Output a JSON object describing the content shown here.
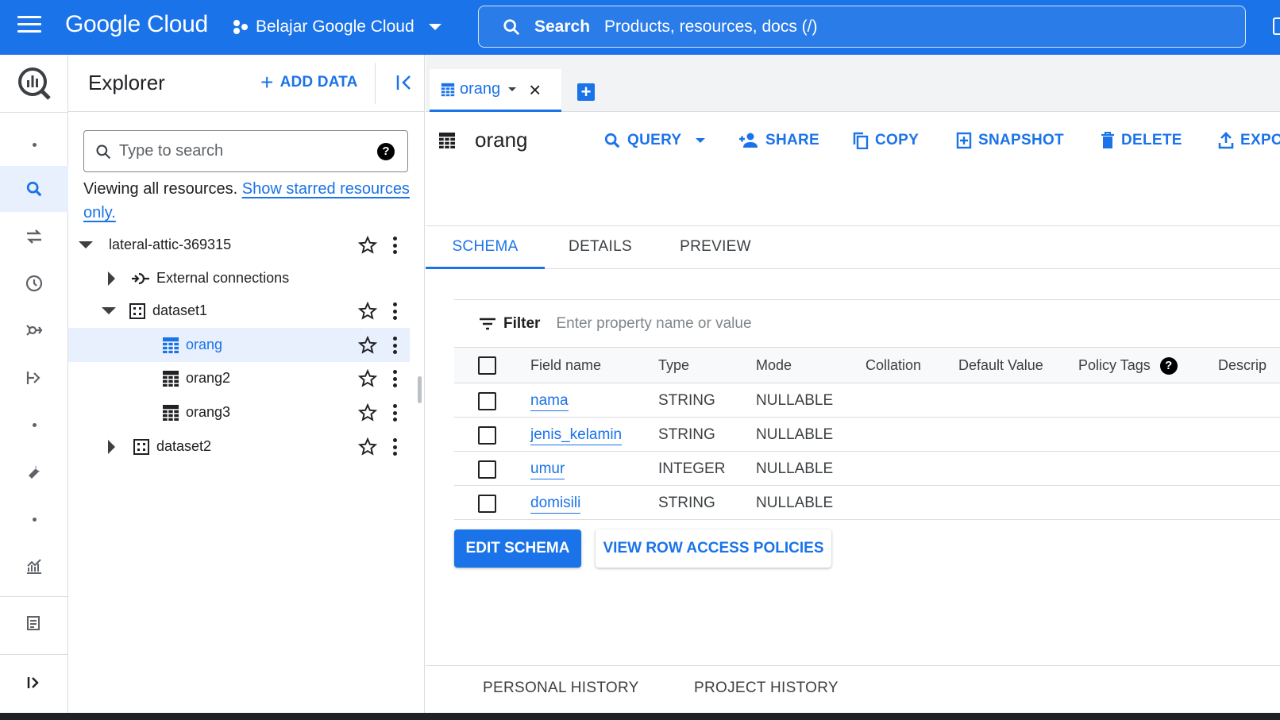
{
  "topbar": {
    "logo": "Google Cloud",
    "project": "Belajar Google Cloud",
    "search_label": "Search",
    "search_placeholder": "Products, resources, docs (/)"
  },
  "explorer": {
    "title": "Explorer",
    "add_data": "ADD DATA",
    "search_placeholder": "Type to search",
    "viewing_text": "Viewing all resources.",
    "viewing_link": "Show starred resources only.",
    "tree": [
      {
        "label": "lateral-attic-369315",
        "type": "project"
      },
      {
        "label": "External connections",
        "type": "connections"
      },
      {
        "label": "dataset1",
        "type": "dataset"
      },
      {
        "label": "orang",
        "type": "table"
      },
      {
        "label": "orang2",
        "type": "table"
      },
      {
        "label": "orang3",
        "type": "table"
      },
      {
        "label": "dataset2",
        "type": "dataset"
      }
    ]
  },
  "tab": {
    "label": "orang"
  },
  "toolbar": {
    "title": "orang",
    "query": "QUERY",
    "share": "SHARE",
    "copy": "COPY",
    "snapshot": "SNAPSHOT",
    "delete": "DELETE",
    "export": "EXPO"
  },
  "subtabs": [
    "SCHEMA",
    "DETAILS",
    "PREVIEW"
  ],
  "schema": {
    "filter_label": "Filter",
    "filter_placeholder": "Enter property name or value",
    "columns": [
      "Field name",
      "Type",
      "Mode",
      "Collation",
      "Default Value",
      "Policy Tags",
      "Descrip"
    ],
    "rows": [
      {
        "name": "nama",
        "type": "STRING",
        "mode": "NULLABLE"
      },
      {
        "name": "jenis_kelamin",
        "type": "STRING",
        "mode": "NULLABLE"
      },
      {
        "name": "umur",
        "type": "INTEGER",
        "mode": "NULLABLE"
      },
      {
        "name": "domisili",
        "type": "STRING",
        "mode": "NULLABLE"
      }
    ]
  },
  "buttons": {
    "edit_schema": "EDIT SCHEMA",
    "view_row_access": "VIEW ROW ACCESS POLICIES"
  },
  "bottom_tabs": [
    "PERSONAL HISTORY",
    "PROJECT HISTORY"
  ],
  "colors": {
    "accent": "#1a73e8",
    "selected_bg": "#e8f0fe"
  }
}
